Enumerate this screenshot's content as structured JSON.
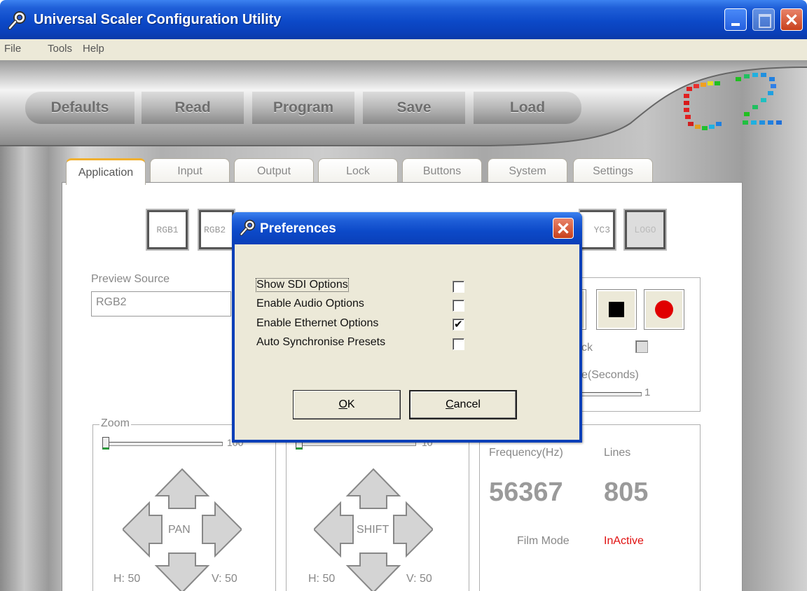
{
  "window": {
    "title": "Universal Scaler Configuration Utility"
  },
  "menu": {
    "items": [
      "File",
      "Tools",
      "Help"
    ]
  },
  "toolbar": {
    "defaults": "Defaults",
    "read": "Read",
    "program": "Program",
    "save": "Save",
    "load": "Load"
  },
  "tabs": [
    "Application",
    "Input",
    "Output",
    "Lock",
    "Buttons",
    "System",
    "Settings"
  ],
  "active_tab": "Application",
  "sources": {
    "rgb1": "RGB1",
    "rgb2": "RGB2",
    "yc3": "YC3",
    "logo": "LOGO"
  },
  "preview": {
    "label": "Preview Source",
    "value": "RGB2"
  },
  "transport": {
    "partial_ck_label": "ck",
    "seconds_label": "e(Seconds)",
    "slider_value": "1"
  },
  "zoom": {
    "label": "Zoom",
    "max_value": "100",
    "level_fraction": 0.0
  },
  "shift_slider": {
    "max_value": "10",
    "level_fraction": 0.0
  },
  "pan": {
    "label": "PAN",
    "h_value": "H: 50",
    "v_value": "V: 50"
  },
  "shift": {
    "label": "SHIFT",
    "h_value": "H: 50",
    "v_value": "V: 50"
  },
  "status": {
    "frequency_label": "Frequency(Hz)",
    "lines_label": "Lines",
    "frequency_value": "56367",
    "lines_value": "805",
    "film_mode_label": "Film Mode",
    "film_mode_value": "InActive",
    "film_mode_color": "#e01010"
  },
  "dialog": {
    "title": "Preferences",
    "options": [
      {
        "label": "Show SDI Options",
        "checked": false
      },
      {
        "label": "Enable Audio Options",
        "checked": false
      },
      {
        "label": "Enable Ethernet Options",
        "checked": true
      },
      {
        "label": "Auto Synchronise Presets",
        "checked": false
      }
    ],
    "ok_hotkey": "O",
    "ok_rest": "K",
    "cancel_hotkey": "C",
    "cancel_rest": "ancel"
  },
  "colors": {
    "titlebar": "#0a3fb8",
    "dialog_face": "#ece9d8",
    "record": "#e00000"
  }
}
